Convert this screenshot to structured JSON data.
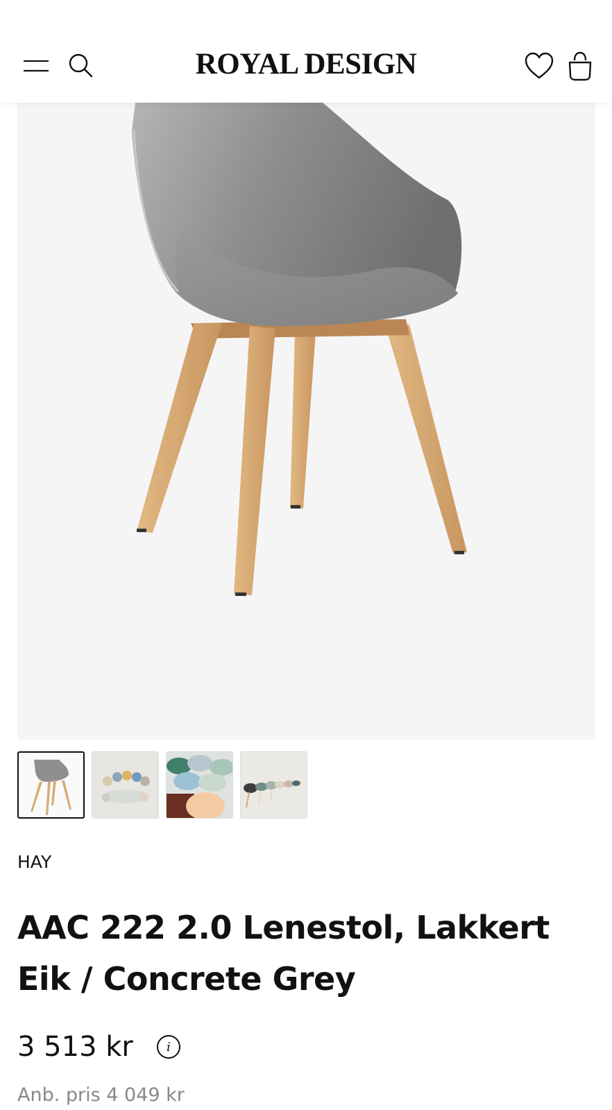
{
  "header": {
    "logo": "ROYAL DESIGN",
    "icons": [
      "hamburger-menu-icon",
      "search-icon",
      "heart-icon",
      "shopping-bag-icon"
    ]
  },
  "product": {
    "brand": "HAY",
    "title": "AAC 222 2.0 Lenestol, Lakkert Eik / Concrete Grey",
    "price": "3 513 kr",
    "info_icon": "i",
    "recommended_price": "Anb. pris 4 049 kr"
  },
  "gallery": {
    "thumbnail_count": 4,
    "active_index": 0
  },
  "colors": {
    "text": "#111111",
    "muted": "#888888",
    "hero_bg": "#f5f5f5",
    "shell": "#8a8a8a",
    "oak": "#d8ab74"
  }
}
